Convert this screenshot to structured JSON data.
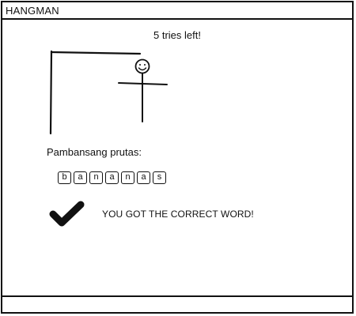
{
  "window": {
    "title": "HANGMAN"
  },
  "game": {
    "tries_left": "5 tries left!",
    "hint_label": "Pambansang prutas:",
    "letters": [
      "b",
      "a",
      "n",
      "a",
      "n",
      "a",
      "s"
    ],
    "result_message": "YOU GOT THE CORRECT WORD!"
  },
  "icons": {
    "result": "checkmark-icon",
    "figure": "hangman-figure-icon"
  },
  "colors": {
    "ink": "#111111",
    "background": "#ffffff"
  }
}
